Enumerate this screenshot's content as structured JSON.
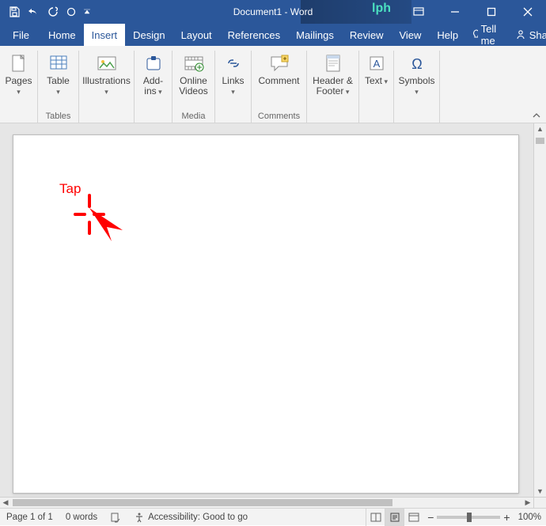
{
  "titlebar": {
    "title": "Document1 - Word",
    "overlay_text": "lph"
  },
  "tabs": {
    "file": "File",
    "home": "Home",
    "insert": "Insert",
    "design": "Design",
    "layout": "Layout",
    "references": "References",
    "mailings": "Mailings",
    "review": "Review",
    "view": "View",
    "help": "Help",
    "tellme": "Tell me",
    "share": "Share"
  },
  "ribbon": {
    "pages": {
      "btn": "Pages",
      "group": ""
    },
    "tables": {
      "btn": "Table",
      "group": "Tables"
    },
    "illustrations": {
      "btn": "Illustrations",
      "group": ""
    },
    "addins": {
      "btn": "Add-\nins",
      "group": ""
    },
    "media": {
      "btn": "Online\nVideos",
      "group": "Media"
    },
    "links": {
      "btn": "Links",
      "group": ""
    },
    "comment": {
      "btn": "Comment",
      "group": "Comments"
    },
    "hf": {
      "btn": "Header &\nFooter",
      "group": ""
    },
    "text": {
      "btn": "Text",
      "group": ""
    },
    "symbols": {
      "btn": "Symbols",
      "group": ""
    }
  },
  "annotation": {
    "tap": "Tap"
  },
  "status": {
    "page": "Page 1 of 1",
    "words": "0 words",
    "accessibility": "Accessibility: Good to go",
    "zoom": "100%"
  }
}
